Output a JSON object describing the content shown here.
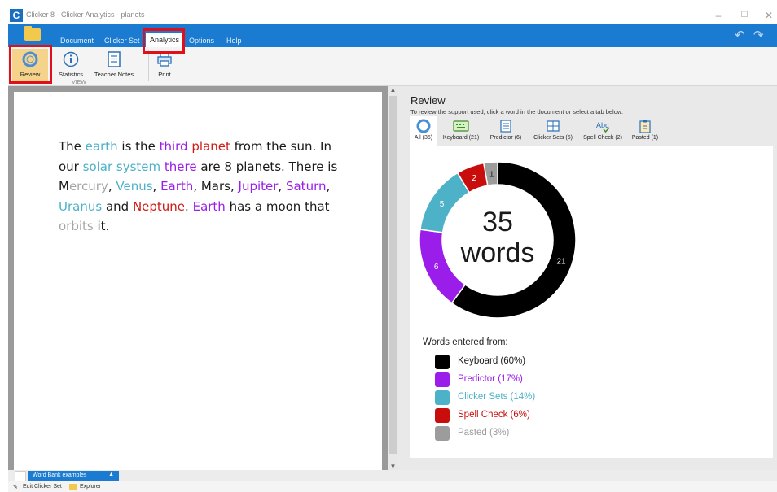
{
  "window": {
    "title": "Clicker 8 - Clicker Analytics - planets",
    "logo_letter": "C",
    "controls": {
      "minimize": "–",
      "maximize": "☐",
      "close": "✕"
    }
  },
  "menu": {
    "items": [
      "Document",
      "Clicker Set",
      "Analytics",
      "Options",
      "Help"
    ],
    "active": "Analytics",
    "undo_icon": "↶",
    "redo_icon": "↷"
  },
  "toolbar": {
    "review_label": "Review",
    "statistics_label": "Statistics",
    "teacher_notes_label": "Teacher Notes",
    "print_label": "Print",
    "group_label": "VIEW"
  },
  "document": {
    "words": [
      {
        "t": "The ",
        "s": "keyboard"
      },
      {
        "t": "earth",
        "s": "clicker_sets"
      },
      {
        "t": " is the ",
        "s": "keyboard"
      },
      {
        "t": "third",
        "s": "predictor"
      },
      {
        "t": " ",
        "s": "keyboard"
      },
      {
        "t": "planet",
        "s": "spell_check"
      },
      {
        "t": " from the sun. In our ",
        "s": "keyboard"
      },
      {
        "t": "solar system",
        "s": "clicker_sets"
      },
      {
        "t": " ",
        "s": "keyboard"
      },
      {
        "t": "there",
        "s": "predictor"
      },
      {
        "t": " are 8 planets. There is M",
        "s": "keyboard"
      },
      {
        "t": "ercury",
        "s": "pasted"
      },
      {
        "t": ", ",
        "s": "keyboard"
      },
      {
        "t": "Venus",
        "s": "clicker_sets"
      },
      {
        "t": ", ",
        "s": "keyboard"
      },
      {
        "t": "Earth",
        "s": "predictor"
      },
      {
        "t": ", Mars, ",
        "s": "keyboard"
      },
      {
        "t": "Jupiter",
        "s": "predictor"
      },
      {
        "t": ", ",
        "s": "keyboard"
      },
      {
        "t": "Saturn",
        "s": "predictor"
      },
      {
        "t": ", ",
        "s": "keyboard"
      },
      {
        "t": "Uranus",
        "s": "clicker_sets"
      },
      {
        "t": " and ",
        "s": "keyboard"
      },
      {
        "t": "Neptune",
        "s": "spell_check"
      },
      {
        "t": ". ",
        "s": "keyboard"
      },
      {
        "t": "Earth",
        "s": "predictor"
      },
      {
        "t": " has a moon that ",
        "s": "keyboard"
      },
      {
        "t": "orbits",
        "s": "pasted"
      },
      {
        "t": " it.",
        "s": "keyboard"
      }
    ]
  },
  "review": {
    "title": "Review",
    "hint": "To review the support used, click a word in the document or select a tab below.",
    "tabs": [
      {
        "label": "All (35)",
        "icon": "donut-icon"
      },
      {
        "label": "Keyboard (21)",
        "icon": "keyboard-icon"
      },
      {
        "label": "Predictor (6)",
        "icon": "predictor-icon"
      },
      {
        "label": "Clicker Sets (5)",
        "icon": "grid-icon"
      },
      {
        "label": "Spell Check (2)",
        "icon": "spellcheck-icon"
      },
      {
        "label": "Pasted (1)",
        "icon": "clipboard-icon"
      }
    ],
    "center_count": "35",
    "center_unit": "words",
    "legend_title": "Words entered from:",
    "legend": [
      {
        "label": "Keyboard (60%)",
        "color": "#000000",
        "text_color": "#1a1a1a"
      },
      {
        "label": "Predictor (17%)",
        "color": "#9b1dea",
        "text_color": "#9b1dea"
      },
      {
        "label": "Clicker Sets (14%)",
        "color": "#4db1c8",
        "text_color": "#4db1c8"
      },
      {
        "label": "Spell Check (6%)",
        "color": "#c90d0d",
        "text_color": "#c90d0d"
      },
      {
        "label": "Pasted (3%)",
        "color": "#9c9c9c",
        "text_color": "#9c9c9c"
      }
    ]
  },
  "chart_data": {
    "type": "pie",
    "categories": [
      "Keyboard",
      "Predictor",
      "Clicker Sets",
      "Spell Check",
      "Pasted"
    ],
    "values": [
      21,
      6,
      5,
      2,
      1
    ],
    "colors": [
      "#000000",
      "#9b1dea",
      "#4db1c8",
      "#c90d0d",
      "#9c9c9c"
    ],
    "labels": [
      "21",
      "6",
      "5",
      "2",
      "1"
    ]
  },
  "colors": {
    "keyboard": "#1a1a1a",
    "predictor": "#9b1dea",
    "clicker_sets": "#4db1c8",
    "spell_check": "#d11a14",
    "pasted": "#a5a5a5",
    "ribbon": "#1a7bd0",
    "highlight": "#e0101a"
  },
  "bottom": {
    "word_bank_tab": "Word Bank examples",
    "edit_clicker_set": "Edit Clicker Set",
    "explorer": "Explorer"
  }
}
